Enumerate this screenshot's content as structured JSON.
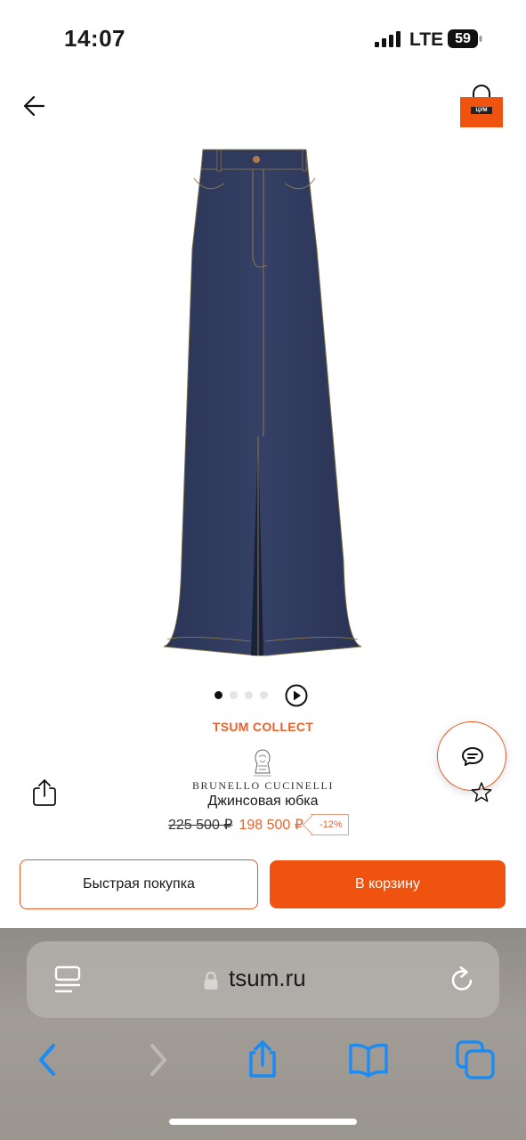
{
  "status_bar": {
    "time": "14:07",
    "network": "LTE",
    "battery": "59"
  },
  "header": {
    "back_icon": "arrow-left-icon",
    "bag_icon": "shopping-bag-icon",
    "bag_logo_text": "ЦУМ"
  },
  "product": {
    "image": "denim-maxi-skirt",
    "gallery_pages": 5,
    "gallery_active_index": 0,
    "collection": "TSUM COLLECT",
    "brand": "BRUNELLO CUCINELLI",
    "title": "Джинсовая юбка",
    "old_price": "225 500 ₽",
    "new_price": "198 500 ₽",
    "discount": "-12%"
  },
  "actions": {
    "quick_buy": "Быстрая покупка",
    "add_to_cart": "В корзину"
  },
  "browser": {
    "url": "tsum.ru",
    "toolbar_icons": [
      "back-icon",
      "forward-icon",
      "share-icon",
      "bookmarks-icon",
      "tabs-icon"
    ]
  },
  "colors": {
    "accent": "#f0520f",
    "ios_blue": "#1d8bf1"
  }
}
